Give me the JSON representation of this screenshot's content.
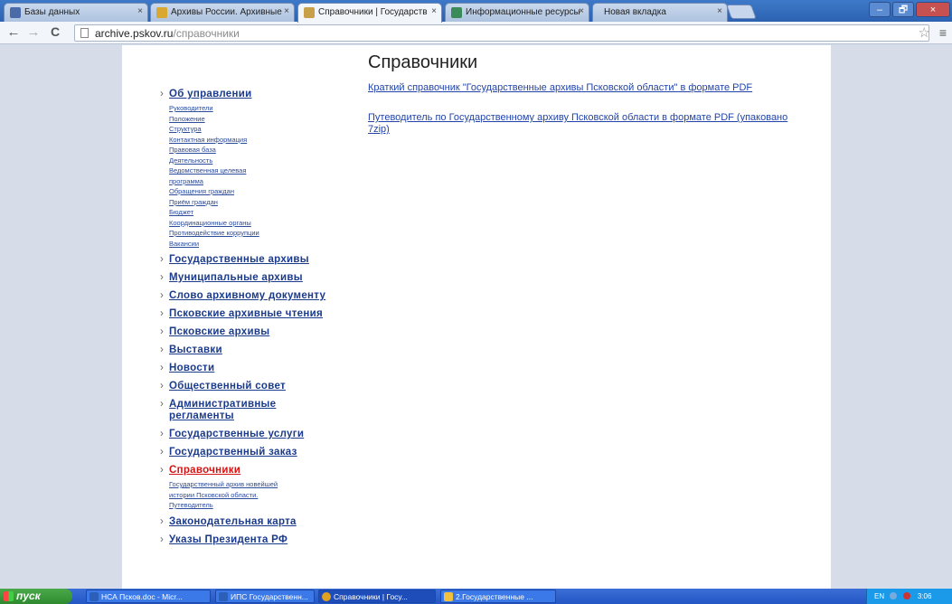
{
  "browser": {
    "tabs": [
      {
        "label": "Базы данных",
        "favicon_color": "#4a6aa8",
        "active": false
      },
      {
        "label": "Архивы России. Архивные",
        "favicon_color": "#d8a830",
        "active": false
      },
      {
        "label": "Справочники | Государств",
        "favicon_color": "#c8a04a",
        "active": true
      },
      {
        "label": "Информационные ресурсы",
        "favicon_color": "#3a8a5a",
        "active": false
      },
      {
        "label": "Новая вкладка",
        "favicon_color": "",
        "active": false
      }
    ],
    "tab_close": "×",
    "url_host": "archive.pskov.ru",
    "url_path": "/справочники",
    "back": "←",
    "forward": "→",
    "reload": "C",
    "star": "☆",
    "menu": "≡"
  },
  "window": {
    "minimize": "–",
    "maximize": "🗗",
    "close": "×"
  },
  "page": {
    "title": "Справочники",
    "links": [
      "Краткий справочник \"Государственные архивы Псковской области\" в формате PDF",
      "Путеводитель по Государственному архиву Псковской области в формате PDF (упаковано 7zip)"
    ]
  },
  "sidebar": {
    "about": {
      "label": "Об управлении",
      "subitems": [
        "Руководители",
        "Положение",
        "Структура",
        "Контактная информация",
        "Правовая база",
        "Деятельность",
        "Ведомственная целевая",
        "программа",
        "Обращения граждан",
        "Приём граждан",
        "Бюджет",
        "Координационные органы",
        "Противодействие коррупции",
        "Вакансии"
      ]
    },
    "items_mid": [
      "Государственные архивы",
      "Муниципальные архивы",
      "Слово архивному документу",
      "Псковские архивные чтения",
      "Псковские архивы",
      "Выставки",
      "Новости",
      "Общественный совет",
      "Административные регламенты",
      "Государственные услуги",
      "Государственный заказ"
    ],
    "active": {
      "label": "Справочники",
      "subitems": [
        "Государственный архив новейшей",
        "истории Псковской области.",
        "Путеводитель"
      ]
    },
    "items_end": [
      "Законодательная карта",
      "Указы Президента РФ"
    ]
  },
  "taskbar": {
    "start": "пуск",
    "tasks": [
      {
        "label": "НСА Псков.doc - Micr...",
        "icon_color": "#2b5fb8"
      },
      {
        "label": "ИПС Государственн...",
        "icon_color": "#2b5fb8"
      },
      {
        "label": "Справочники | Госу...",
        "icon_color": "#e0a020"
      },
      {
        "label": "2.Государственные ...",
        "icon_color": "#f0c040"
      }
    ],
    "lang": "EN",
    "time": "3:06"
  }
}
